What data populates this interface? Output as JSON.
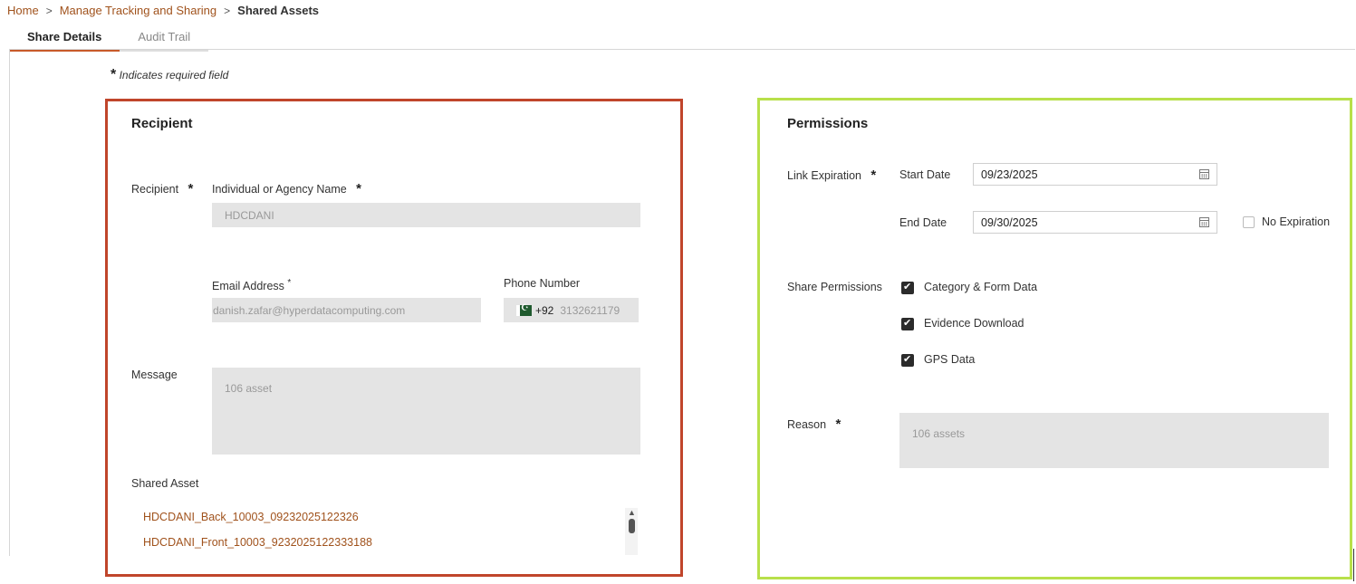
{
  "breadcrumb": {
    "home": "Home",
    "section": "Manage Tracking and Sharing",
    "current": "Shared Assets",
    "separator": ">"
  },
  "tabs": [
    {
      "label": "Share Details",
      "active": true
    },
    {
      "label": "Audit Trail",
      "active": false
    }
  ],
  "required_note": {
    "star": "*",
    "text": "Indicates required field"
  },
  "recipient": {
    "heading": "Recipient",
    "recipient_label": "Recipient",
    "name_label": "Individual or Agency Name",
    "name_value": "HDCDANI",
    "email_label": "Email Address",
    "email_value": "danish.zafar@hyperdatacomputing.com",
    "phone_label": "Phone Number",
    "phone_code": "+92",
    "phone_value": "3132621179",
    "message_label": "Message",
    "message_value": "106 asset",
    "shared_asset_label": "Shared Asset",
    "assets": [
      "HDCDANI_Back_10003_09232025122326",
      "HDCDANI_Front_10003_9232025122333188"
    ]
  },
  "permissions": {
    "heading": "Permissions",
    "link_expiration_label": "Link Expiration",
    "start_date_label": "Start Date",
    "start_date_value": "09/23/2025",
    "end_date_label": "End Date",
    "end_date_value": "09/30/2025",
    "no_expiration_label": "No Expiration",
    "no_expiration_checked": false,
    "share_permissions_label": "Share Permissions",
    "options": [
      {
        "label": "Category & Form Data",
        "checked": true
      },
      {
        "label": "Evidence Download",
        "checked": true
      },
      {
        "label": "GPS Data",
        "checked": true
      }
    ],
    "reason_label": "Reason",
    "reason_value": "106 assets"
  },
  "required_star": "*",
  "colors": {
    "accent": "#a0521c",
    "recipient_frame": "#c0452b",
    "permissions_frame": "#b8e04a",
    "field_bg": "#e4e4e4"
  }
}
